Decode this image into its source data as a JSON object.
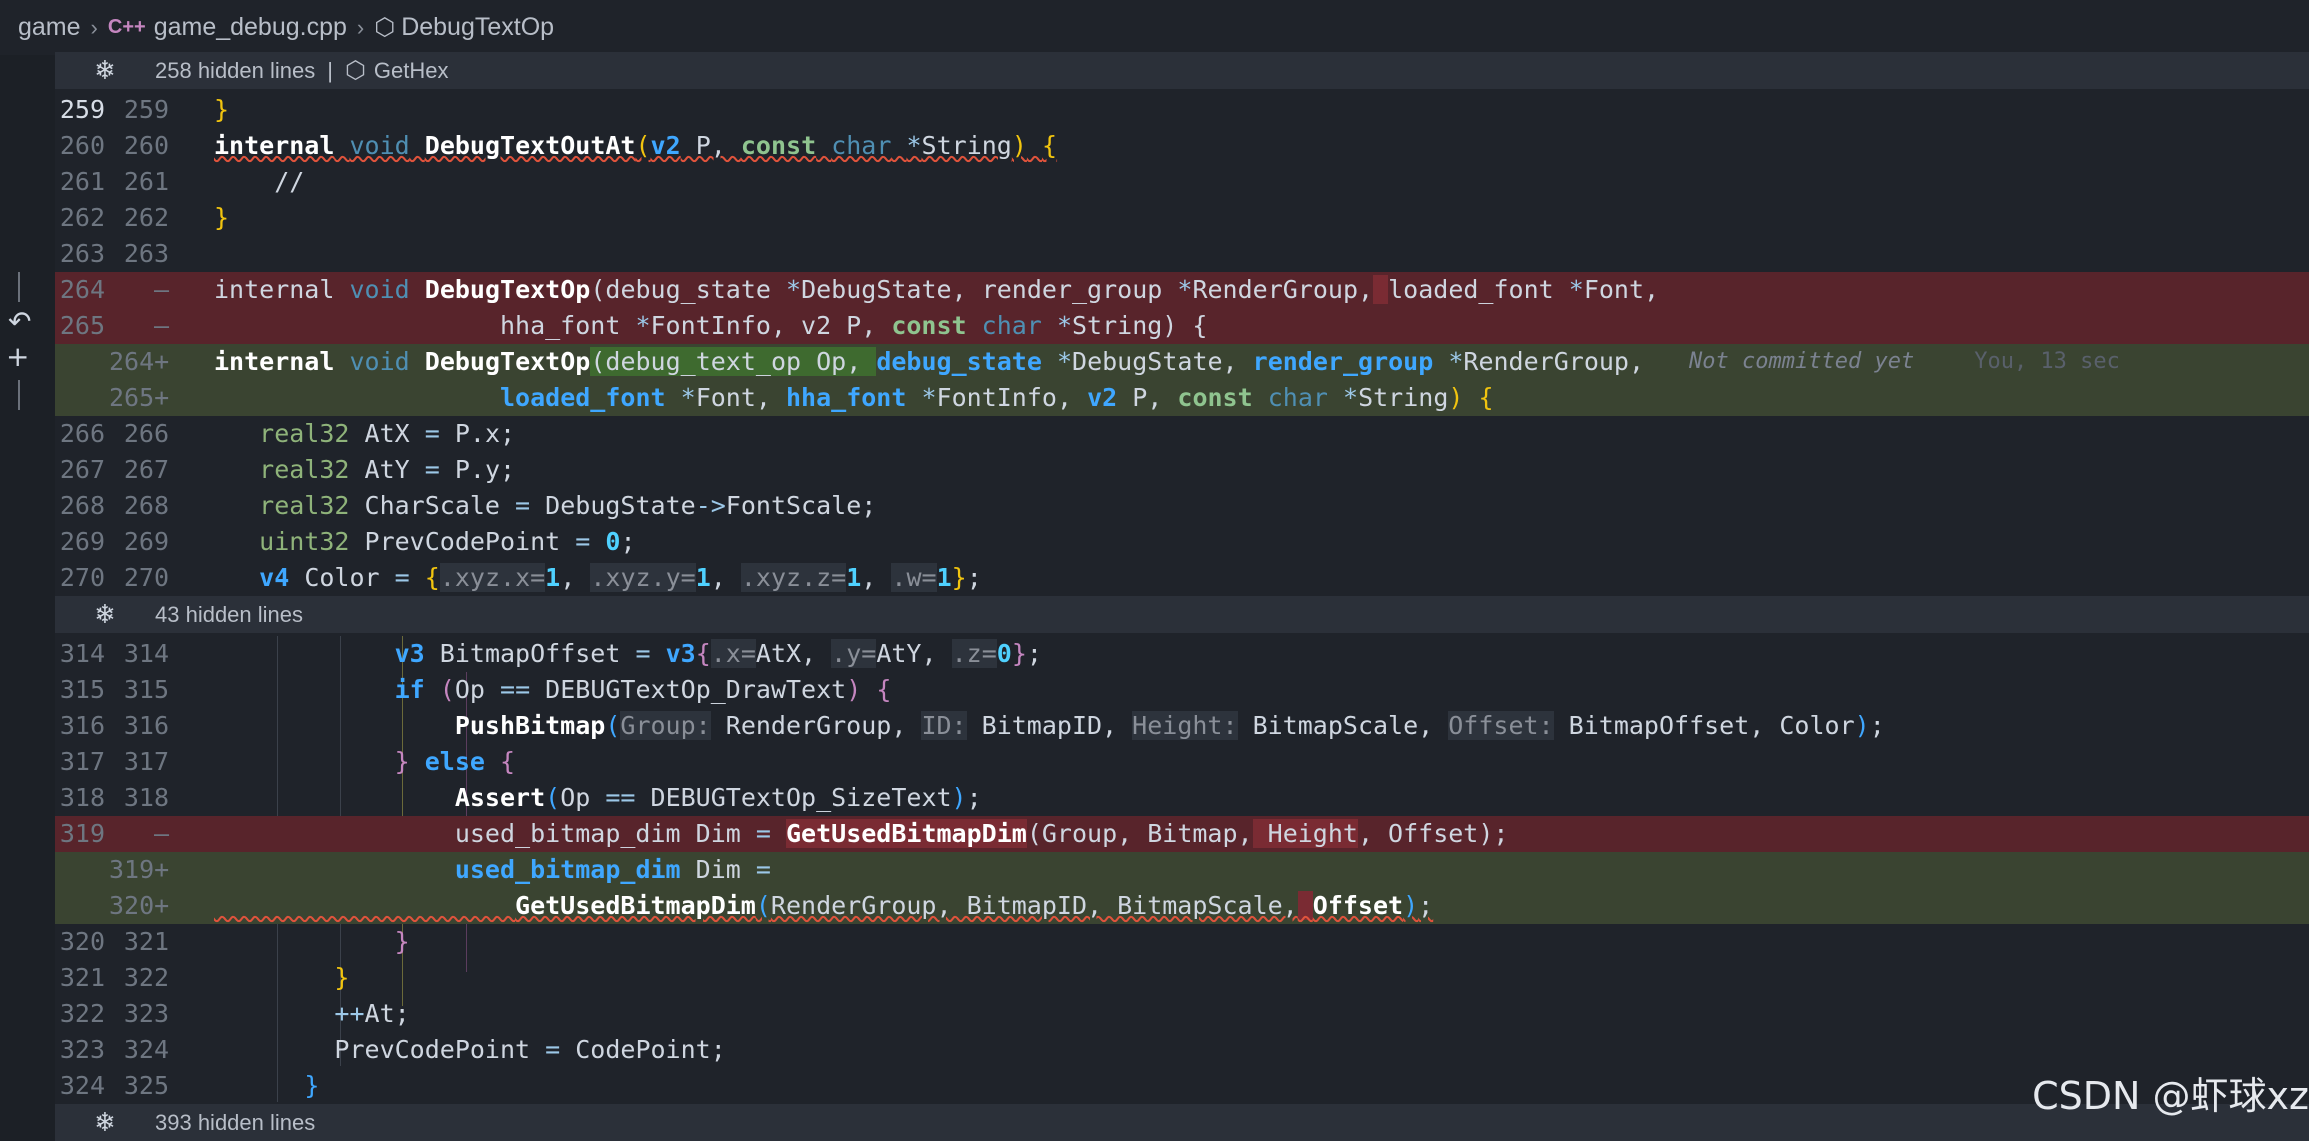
{
  "breadcrumb": {
    "folder": "game",
    "file_icon": "C++",
    "file": "game_debug.cpp",
    "symbol": "DebugTextOp"
  },
  "folds": [
    {
      "label": "258 hidden lines",
      "extra": "GetHex"
    },
    {
      "label": "43 hidden lines"
    },
    {
      "label": "393 hidden lines"
    }
  ],
  "blame": {
    "text": "Not committed yet",
    "author": "You, 13 sec"
  },
  "lines": {
    "l259": {
      "o": "259",
      "n": "259"
    },
    "l260": {
      "o": "260",
      "n": "260"
    },
    "l261": {
      "o": "261",
      "n": "261"
    },
    "l262": {
      "o": "262",
      "n": "262"
    },
    "l263": {
      "o": "263",
      "n": "263"
    },
    "d264": {
      "o": "264",
      "n": "—"
    },
    "d265": {
      "o": "265",
      "n": "—"
    },
    "a264": {
      "o": "",
      "n": "264+"
    },
    "a265": {
      "o": "",
      "n": "265+"
    },
    "l266": {
      "o": "266",
      "n": "266"
    },
    "l267": {
      "o": "267",
      "n": "267"
    },
    "l268": {
      "o": "268",
      "n": "268"
    },
    "l269": {
      "o": "269",
      "n": "269"
    },
    "l270": {
      "o": "270",
      "n": "270"
    },
    "l314": {
      "o": "314",
      "n": "314"
    },
    "l315": {
      "o": "315",
      "n": "315"
    },
    "l316": {
      "o": "316",
      "n": "316"
    },
    "l317": {
      "o": "317",
      "n": "317"
    },
    "l318": {
      "o": "318",
      "n": "318"
    },
    "d319": {
      "o": "319",
      "n": "—"
    },
    "a319": {
      "o": "",
      "n": "319+"
    },
    "a320": {
      "o": "",
      "n": "320+"
    },
    "l321": {
      "o": "320",
      "n": "321"
    },
    "l322": {
      "o": "321",
      "n": "322"
    },
    "l323": {
      "o": "322",
      "n": "323"
    },
    "l324": {
      "o": "323",
      "n": "324"
    },
    "l325": {
      "o": "324",
      "n": "325"
    }
  },
  "watermark": "CSDN @虾球xz",
  "colors": {
    "deleted": "#58242b",
    "added": "#3a4431",
    "fold": "#2b3039",
    "bg": "#1f232a"
  }
}
